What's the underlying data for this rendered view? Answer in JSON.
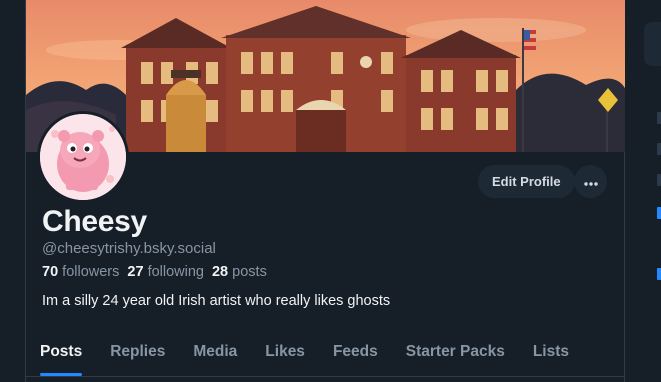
{
  "profile": {
    "display_name": "Cheesy",
    "handle": "@cheesytrishy.bsky.social",
    "bio": "Im a silly 24 year old Irish artist who really likes ghosts",
    "stats": {
      "followers_count": "70",
      "followers_label": "followers",
      "following_count": "27",
      "following_label": "following",
      "posts_count": "28",
      "posts_label": "posts"
    }
  },
  "actions": {
    "edit_profile_label": "Edit Profile",
    "more_icon": "ellipsis-icon"
  },
  "tabs": [
    {
      "label": "Posts",
      "active": true
    },
    {
      "label": "Replies"
    },
    {
      "label": "Media"
    },
    {
      "label": "Likes"
    },
    {
      "label": "Feeds"
    },
    {
      "label": "Starter Packs"
    },
    {
      "label": "Lists"
    }
  ],
  "colors": {
    "background": "#161e27",
    "accent": "#208bfe",
    "muted_text": "#8796a5",
    "button_bg": "#1e2936"
  }
}
